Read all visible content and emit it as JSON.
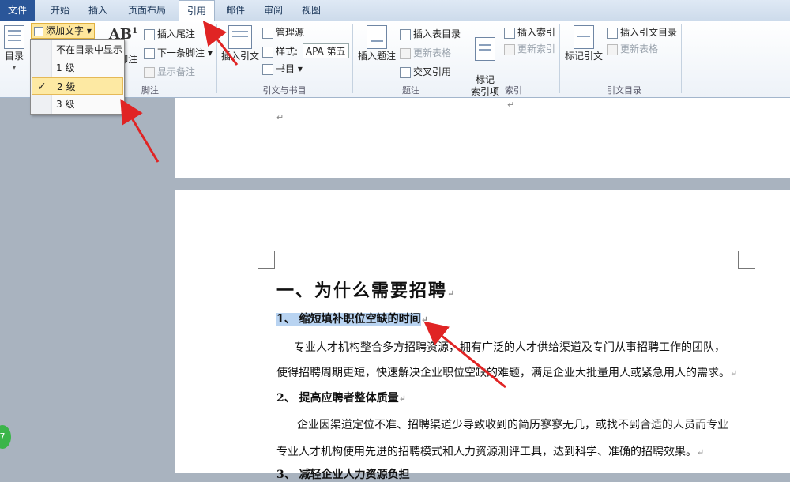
{
  "tabs": [
    "文件",
    "开始",
    "插入",
    "页面布局",
    "引用",
    "邮件",
    "审阅",
    "视图"
  ],
  "ribbon": {
    "toc": {
      "label": "目录",
      "arrow": "▾"
    },
    "add_text": {
      "label": "添加文字",
      "arrow": "▾"
    },
    "dropdown": [
      "不在目录中显示",
      "1 级",
      "2 级",
      "3 级"
    ],
    "dropdown_check": "✓",
    "footnote": {
      "insert_footnote_partial": "脚注",
      "insert_endnote": "插入尾注",
      "next_footnote": "下一条脚注",
      "show_notes": "显示备注",
      "group": "脚注"
    },
    "citation": {
      "insert_citation": "插入引文",
      "manage_sources": "管理源",
      "style_label": "样式:",
      "style_value": "APA 第五",
      "bibliography": "书目",
      "group": "引文与书目"
    },
    "captions": {
      "insert_caption": "插入题注",
      "insert_table_figures": "插入表目录",
      "update_table": "更新表格",
      "cross_ref": "交叉引用",
      "group": "题注"
    },
    "index": {
      "mark_entry": "标记\n索引项",
      "insert_index": "插入索引",
      "update_index": "更新索引",
      "group": "索引"
    },
    "toa": {
      "mark_citation": "标记引文",
      "insert_toa": "插入引文目录",
      "update_table": "更新表格",
      "group": "引文目录"
    }
  },
  "document": {
    "heading1": "一、为什么需要招聘",
    "heading2_1": "1、 缩短填补职位空缺的时间",
    "para1_line1": "专业人才机构整合多方招聘资源，拥有广泛的人才供给渠道及专门从事招聘工作的团队，",
    "para1_line2": "使得招聘周期更短，快速解决企业职位空缺的难题，满足企业大批量用人或紧急用人的需求。",
    "heading2_2": "2、 提高应聘者整体质量",
    "para2_line1": "企业因渠道定位不准、招聘渠道少导致收到的简历寥寥无几，或找不到合适的人员而专业",
    "para2_line2": "专业人才机构使用先进的招聘模式和人力资源测评工具，达到科学、准确的招聘效果。",
    "heading2_3_partial": "3、 减轻企业人力资源负担",
    "para_mark": "↵",
    "watermark": "Baidu 经验",
    "green_badge": "7"
  }
}
